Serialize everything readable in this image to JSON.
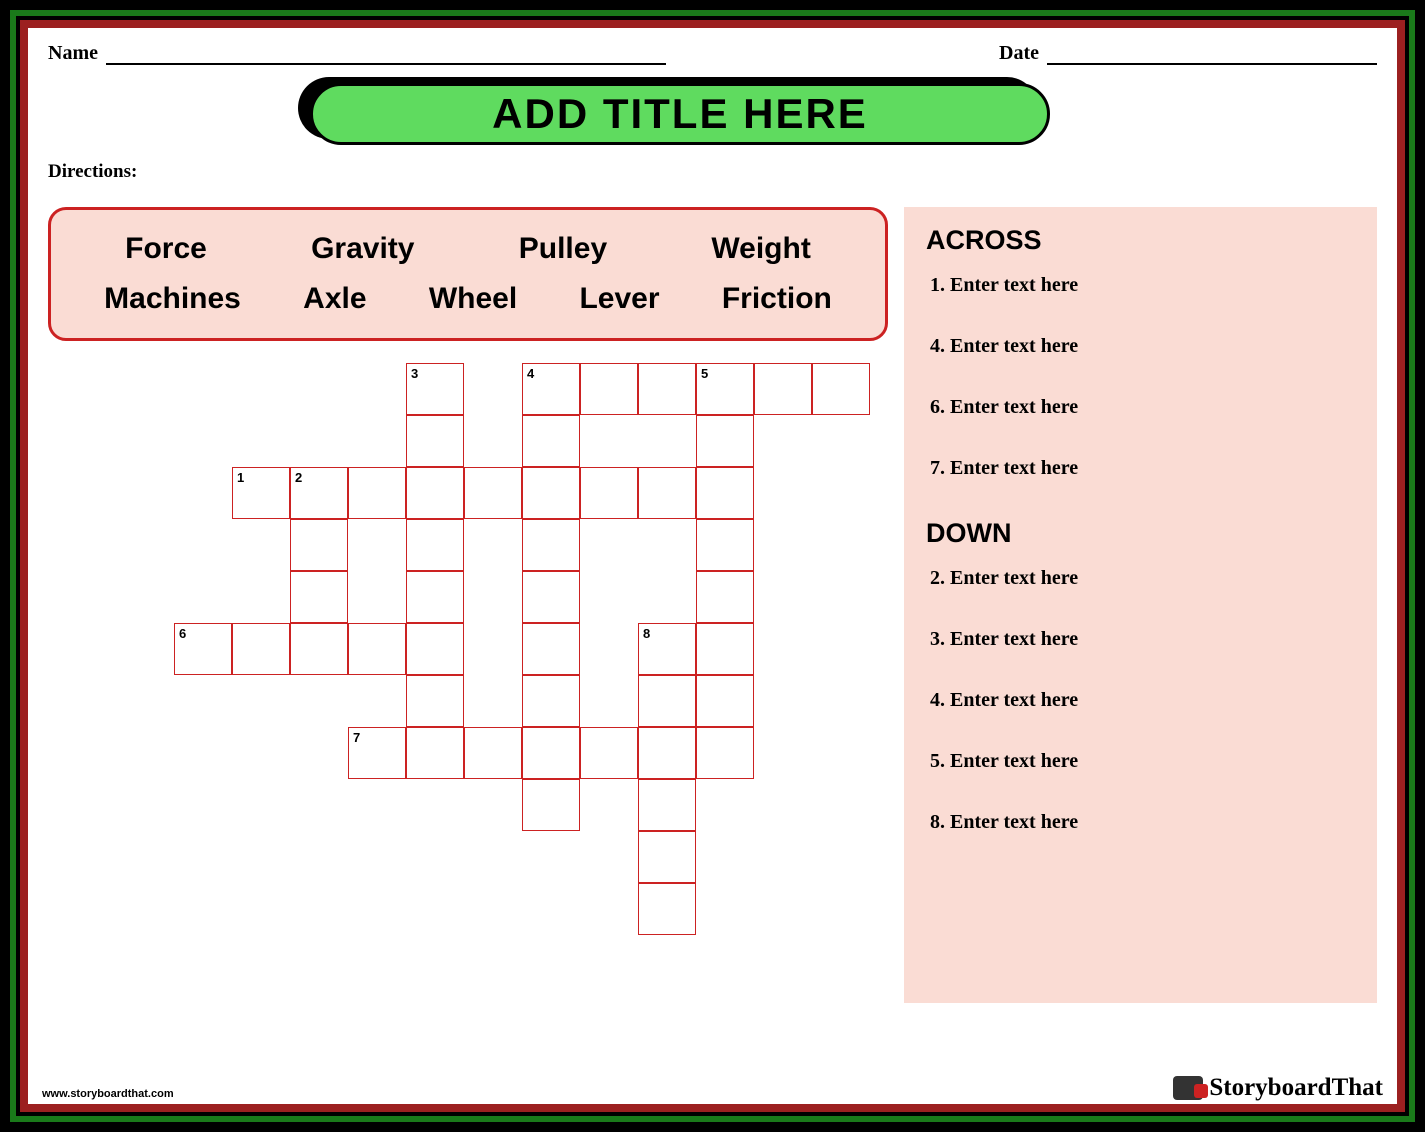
{
  "header": {
    "name_label": "Name",
    "date_label": "Date"
  },
  "title": "ADD TITLE HERE",
  "directions_label": "Directions:",
  "word_bank": {
    "row1": [
      "Force",
      "Gravity",
      "Pulley",
      "Weight"
    ],
    "row2": [
      "Machines",
      "Axle",
      "Wheel",
      "Lever",
      "Friction"
    ]
  },
  "crossword": {
    "cell_size": {
      "w": 58,
      "h": 52
    },
    "cells": [
      {
        "c": 6,
        "r": 0,
        "n": "3"
      },
      {
        "c": 8,
        "r": 0,
        "n": "4"
      },
      {
        "c": 9,
        "r": 0
      },
      {
        "c": 10,
        "r": 0
      },
      {
        "c": 11,
        "r": 0,
        "n": "5"
      },
      {
        "c": 12,
        "r": 0
      },
      {
        "c": 13,
        "r": 0
      },
      {
        "c": 6,
        "r": 1
      },
      {
        "c": 8,
        "r": 1
      },
      {
        "c": 11,
        "r": 1
      },
      {
        "c": 3,
        "r": 2,
        "n": "1"
      },
      {
        "c": 4,
        "r": 2,
        "n": "2"
      },
      {
        "c": 5,
        "r": 2
      },
      {
        "c": 6,
        "r": 2
      },
      {
        "c": 7,
        "r": 2
      },
      {
        "c": 8,
        "r": 2
      },
      {
        "c": 9,
        "r": 2
      },
      {
        "c": 10,
        "r": 2
      },
      {
        "c": 11,
        "r": 2
      },
      {
        "c": 4,
        "r": 3
      },
      {
        "c": 6,
        "r": 3
      },
      {
        "c": 8,
        "r": 3
      },
      {
        "c": 11,
        "r": 3
      },
      {
        "c": 4,
        "r": 4
      },
      {
        "c": 6,
        "r": 4
      },
      {
        "c": 8,
        "r": 4
      },
      {
        "c": 11,
        "r": 4
      },
      {
        "c": 2,
        "r": 5,
        "n": "6"
      },
      {
        "c": 3,
        "r": 5
      },
      {
        "c": 4,
        "r": 5
      },
      {
        "c": 5,
        "r": 5
      },
      {
        "c": 6,
        "r": 5
      },
      {
        "c": 8,
        "r": 5
      },
      {
        "c": 10,
        "r": 5,
        "n": "8"
      },
      {
        "c": 11,
        "r": 5
      },
      {
        "c": 6,
        "r": 6
      },
      {
        "c": 8,
        "r": 6
      },
      {
        "c": 10,
        "r": 6
      },
      {
        "c": 11,
        "r": 6
      },
      {
        "c": 5,
        "r": 7,
        "n": "7"
      },
      {
        "c": 6,
        "r": 7
      },
      {
        "c": 7,
        "r": 7
      },
      {
        "c": 8,
        "r": 7
      },
      {
        "c": 9,
        "r": 7
      },
      {
        "c": 10,
        "r": 7
      },
      {
        "c": 11,
        "r": 7
      },
      {
        "c": 8,
        "r": 8
      },
      {
        "c": 10,
        "r": 8
      },
      {
        "c": 10,
        "r": 9
      },
      {
        "c": 10,
        "r": 10
      }
    ]
  },
  "clues": {
    "across_heading": "ACROSS",
    "across": [
      {
        "n": "1",
        "text": "Enter text here"
      },
      {
        "n": "4",
        "text": "Enter text here"
      },
      {
        "n": "6",
        "text": "Enter text here"
      },
      {
        "n": "7",
        "text": "Enter text here"
      }
    ],
    "down_heading": "DOWN",
    "down": [
      {
        "n": "2",
        "text": "Enter text here"
      },
      {
        "n": "3",
        "text": "Enter text here"
      },
      {
        "n": "4",
        "text": "Enter text here"
      },
      {
        "n": "5",
        "text": "Enter text here"
      },
      {
        "n": "8",
        "text": "Enter text here"
      }
    ]
  },
  "footer_url": "www.storyboardthat.com",
  "brand": "StoryboardThat"
}
